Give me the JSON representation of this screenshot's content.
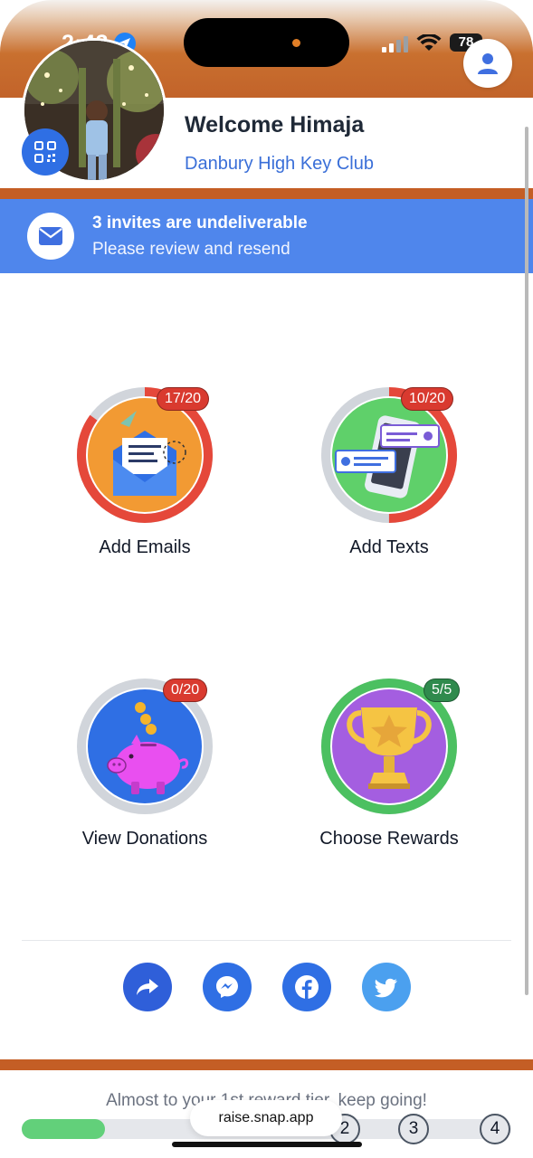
{
  "status_bar": {
    "time": "2:43",
    "battery": "78"
  },
  "header": {
    "welcome": "Welcome Himaja",
    "club": "Danbury High Key Club"
  },
  "banner": {
    "title": "3 invites are undeliverable",
    "subtitle": "Please review and resend"
  },
  "tiles": [
    {
      "label": "Add Emails",
      "badge": "17/20",
      "progress": 0.85,
      "color": "#e5483a"
    },
    {
      "label": "Add Texts",
      "badge": "10/20",
      "progress": 0.5,
      "color": "#e5483a"
    },
    {
      "label": "View Donations",
      "badge": "0/20",
      "progress": 0.0,
      "color": "#e5483a"
    },
    {
      "label": "Choose Rewards",
      "badge": "5/5",
      "progress": 1.0,
      "color": "#4cc061"
    }
  ],
  "share_icons": [
    "share-arrow-icon",
    "messenger-icon",
    "facebook-icon",
    "twitter-icon"
  ],
  "footer": {
    "progress_text": "Almost to your 1st reward tier, keep going!",
    "progress_fraction": 0.17,
    "tiers": [
      "2",
      "3",
      "4"
    ],
    "url": "raise.snap.app"
  },
  "colors": {
    "brand_orange": "#c45e25",
    "banner_blue": "#4f86ec",
    "link_blue": "#3a6fd8",
    "progress_green": "#62d07a"
  }
}
